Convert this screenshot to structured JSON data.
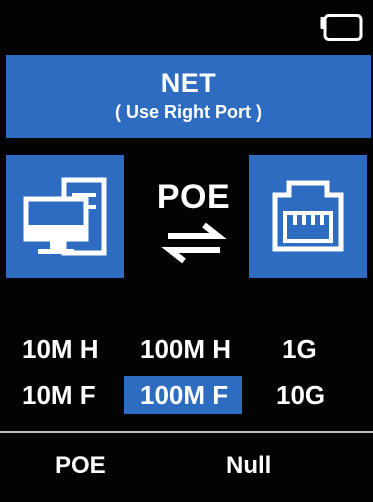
{
  "status_bar": {
    "battery_icon": "battery-icon"
  },
  "header": {
    "title": "NET",
    "subtitle": "( Use Right Port )"
  },
  "link": {
    "left_icon": "computer-icon",
    "label": "POE",
    "arrows_icon": "bidirectional-arrows-icon",
    "right_icon": "ethernet-port-icon"
  },
  "speeds": {
    "row1": [
      "10M H",
      "100M H",
      "1G"
    ],
    "row2": [
      "10M F",
      "100M F",
      "10G"
    ],
    "selected": "100M F"
  },
  "softkeys": {
    "left": "POE",
    "right": "Null"
  },
  "colors": {
    "accent": "#2e6cc2",
    "background": "#030303",
    "text": "#ffffff"
  }
}
